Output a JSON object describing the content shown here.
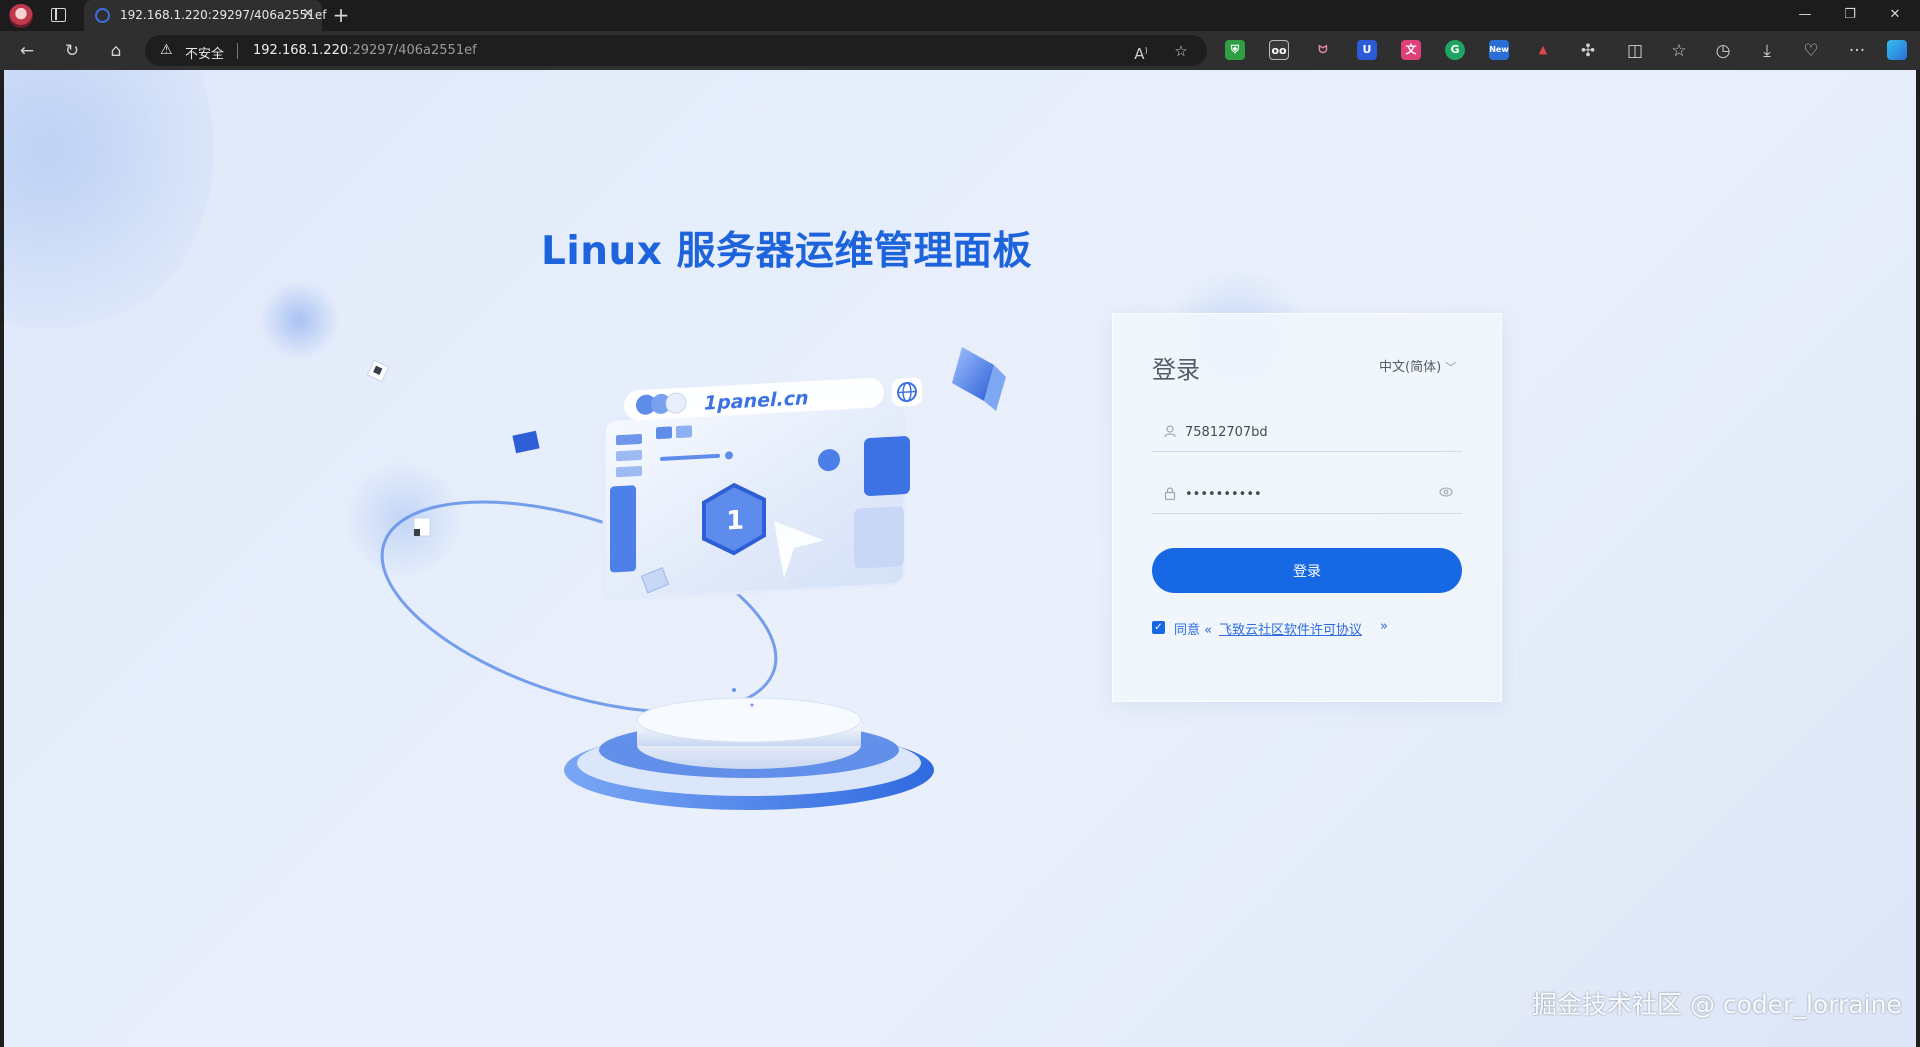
{
  "browser": {
    "tab_title": "192.168.1.220:29297/406a2551ef",
    "new_tab_symbol": "+",
    "security_label": "不安全",
    "url_host": "192.168.1.220",
    "url_rest": ":29297/406a2551ef",
    "extensions": [
      {
        "name": "shield-extension",
        "color": "#2ea043",
        "glyph": ""
      },
      {
        "name": "new-extension-badge",
        "color": "#2b6fd6",
        "glyph": "New"
      }
    ]
  },
  "page": {
    "heading": "Linux 服务器运维管理面板",
    "illustration_label": "1panel.cn"
  },
  "login": {
    "title": "登录",
    "language": "中文(简体)",
    "username_value": "75812707bd",
    "password_value": "••••••••••",
    "submit_label": "登录",
    "agree_prefix": "同意 «",
    "agree_link": "飞致云社区软件许可协议",
    "agree_suffix": "»",
    "agree_checked": true
  },
  "watermark": "掘金技术社区 @ coder_lorraine",
  "colors": {
    "accent": "#1768e4",
    "heading": "#1d63dc"
  }
}
